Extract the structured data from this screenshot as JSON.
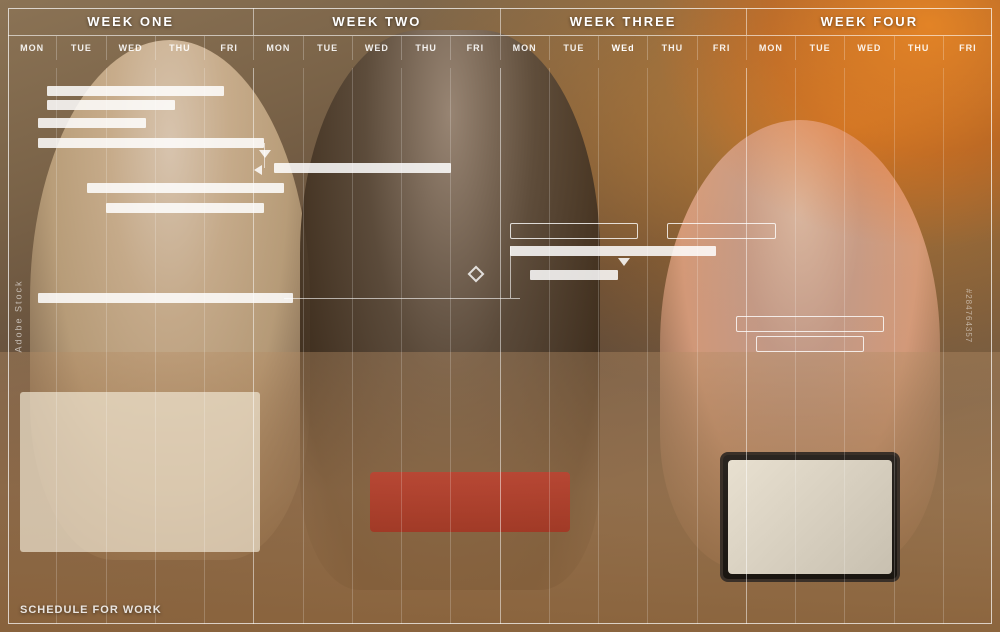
{
  "gantt": {
    "weeks": [
      {
        "label": "WEEK ONE"
      },
      {
        "label": "WEEK TWO"
      },
      {
        "label": "WEEK THREE"
      },
      {
        "label": "WEEK FOUR"
      }
    ],
    "days": [
      "MON",
      "TUE",
      "WED",
      "THU",
      "FRI",
      "MON",
      "TUE",
      "WED",
      "THU",
      "FRI",
      "MON",
      "TUE",
      "WED",
      "THU",
      "FRI",
      "MON",
      "TUE",
      "WED",
      "THU",
      "FRI"
    ],
    "highlight_day": "WEd",
    "bottom_text": "SCHEDULE FOR WORK",
    "bars": [
      {
        "row": 1,
        "start_pct": 4,
        "width_pct": 18,
        "type": "solid"
      },
      {
        "row": 1,
        "start_pct": 6,
        "width_pct": 12,
        "type": "solid"
      },
      {
        "row": 2,
        "start_pct": 3,
        "width_pct": 10,
        "type": "solid"
      },
      {
        "row": 3,
        "start_pct": 5,
        "width_pct": 22,
        "type": "solid"
      },
      {
        "row": 4,
        "start_pct": 26,
        "width_pct": 18,
        "type": "solid",
        "arrow_left": true
      },
      {
        "row": 5,
        "start_pct": 8,
        "width_pct": 20,
        "type": "solid"
      },
      {
        "row": 6,
        "start_pct": 10,
        "width_pct": 15,
        "type": "solid"
      },
      {
        "row": 7,
        "start_pct": 55,
        "width_pct": 12,
        "type": "outline"
      },
      {
        "row": 7,
        "start_pct": 70,
        "width_pct": 10,
        "type": "outline"
      },
      {
        "row": 8,
        "start_pct": 52,
        "width_pct": 20,
        "type": "solid"
      },
      {
        "row": 9,
        "start_pct": 54,
        "width_pct": 8,
        "type": "solid"
      },
      {
        "row": 10,
        "start_pct": 3,
        "width_pct": 25,
        "type": "solid"
      },
      {
        "row": 11,
        "start_pct": 75,
        "width_pct": 14,
        "type": "outline"
      },
      {
        "row": 12,
        "start_pct": 77,
        "width_pct": 10,
        "type": "outline"
      }
    ]
  },
  "watermark": {
    "adobe": "Adobe Stock",
    "stock_id": "#284764357"
  }
}
